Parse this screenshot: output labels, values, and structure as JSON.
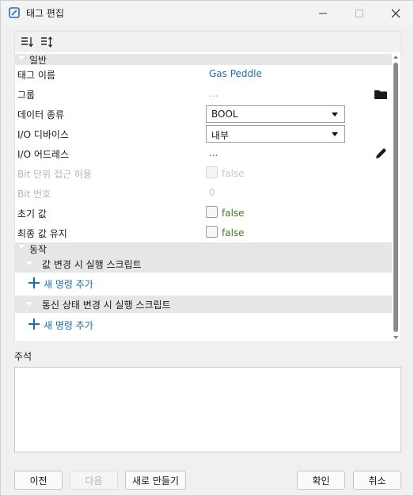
{
  "window": {
    "title": "태그 편집",
    "app_icon": "tag-edit-app-icon",
    "controls": [
      "minimize-icon",
      "maximize-icon",
      "close-icon"
    ]
  },
  "toolbar": {
    "icons": [
      "sort-categorized-icon",
      "sort-alphabetical-icon"
    ]
  },
  "property_grid": {
    "general": {
      "label": "일반",
      "rows": [
        {
          "name": "태그 이름",
          "value": "Gas Peddle"
        },
        {
          "name": "그룹",
          "value": "..."
        },
        {
          "name": "데이터 종류",
          "value": "BOOL"
        },
        {
          "name": "I/O 디바이스",
          "value": "내부"
        },
        {
          "name": "I/O 어드레스",
          "value": "..."
        },
        {
          "name": "Bit 단위 접근 허용",
          "value": "false"
        },
        {
          "name": "Bit 번호",
          "value": "0"
        },
        {
          "name": "초기 값",
          "value": "false"
        },
        {
          "name": "최종 값 유지",
          "value": "false"
        }
      ]
    },
    "action": {
      "label": "동작",
      "value_change_script": {
        "label": "값 변경 시 실행 스크립트",
        "add_label": "새 명령 추가"
      },
      "comm_state_script": {
        "label": "통신 상태 변경 시 실행 스크립트",
        "add_label": "새 명령 추가"
      }
    }
  },
  "comment": {
    "label": "주석",
    "value": ""
  },
  "buttons": {
    "prev": "이전",
    "next": "다음",
    "new": "새로 만들기",
    "ok": "확인",
    "cancel": "취소"
  },
  "colors": {
    "link": "#1e6fa8",
    "false_value": "#3a7d1d",
    "category_bg": "#e6e6e6"
  }
}
